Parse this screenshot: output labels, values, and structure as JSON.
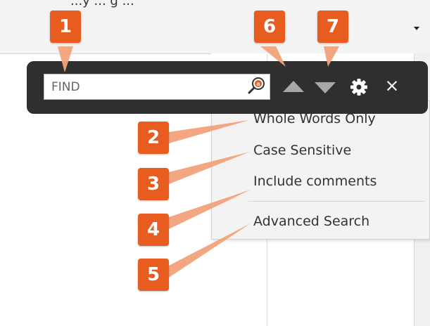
{
  "top_cut_text": "...y ... g ...",
  "find": {
    "placeholder": "FIND",
    "icons": {
      "search": "search-icon",
      "previous": "arrow-up-icon",
      "next": "arrow-down-icon",
      "settings": "gear-icon",
      "close": "close-icon"
    },
    "close_label": "×"
  },
  "menu": {
    "items": [
      "Whole Words Only",
      "Case Sensitive",
      "Include comments",
      "Advanced Search"
    ]
  },
  "callouts": [
    "1",
    "2",
    "3",
    "4",
    "5",
    "6",
    "7"
  ],
  "colors": {
    "callout": "#e85d1f",
    "callout_light": "#f2a27c",
    "findbar": "#2f2f2f",
    "menu_bg": "#f3f3f3"
  }
}
